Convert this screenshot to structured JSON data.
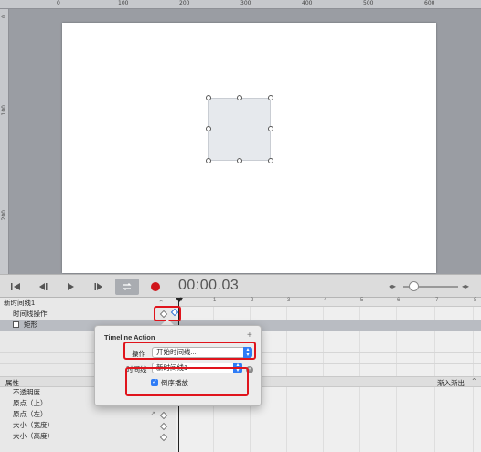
{
  "ruler_top": {
    "labels": [
      "0",
      "100",
      "200",
      "300",
      "400",
      "500",
      "600"
    ]
  },
  "ruler_left": {
    "labels": [
      "0",
      "100",
      "200"
    ]
  },
  "transport": {
    "timecode": "00:00.03",
    "icons": [
      "skip-to-start-icon",
      "step-back-icon",
      "play-icon",
      "step-forward-icon",
      "loop-icon",
      "record-icon"
    ]
  },
  "timeline": {
    "name": "新时间线1",
    "rows": [
      {
        "label": "时间线操作"
      },
      {
        "label": "矩形"
      }
    ],
    "ticks": [
      "0",
      "1",
      "2",
      "3",
      "4",
      "5",
      "6",
      "7",
      "8"
    ]
  },
  "properties": {
    "header": "属性",
    "easing": "渐入渐出",
    "items": [
      "不透明度",
      "原点（上）",
      "原点（左）",
      "大小（宽度）",
      "大小（高度）"
    ]
  },
  "popover": {
    "title": "Timeline Action",
    "action_label": "操作",
    "action_value": "开始时间线...",
    "timeline_label": "时间线",
    "timeline_value": "新时间线1",
    "reverse_label": "倒序播放",
    "reverse_checked": true
  },
  "colors": {
    "accent": "#2f7cf6",
    "record": "#d0141a",
    "highlight_box": "#e0141c"
  }
}
